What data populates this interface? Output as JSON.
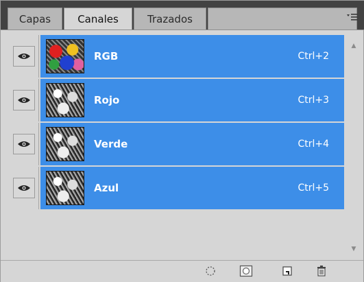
{
  "tabs": [
    {
      "label": "Capas",
      "active": false
    },
    {
      "label": "Canales",
      "active": true
    },
    {
      "label": "Trazados",
      "active": false
    }
  ],
  "panel_menu_icon": "panel-menu-icon",
  "channels": [
    {
      "name": "RGB",
      "shortcut": "Ctrl+2",
      "thumbnail": "color",
      "visible": true,
      "selected": true
    },
    {
      "name": "Rojo",
      "shortcut": "Ctrl+3",
      "thumbnail": "grayscale",
      "visible": true,
      "selected": true
    },
    {
      "name": "Verde",
      "shortcut": "Ctrl+4",
      "thumbnail": "grayscale",
      "visible": true,
      "selected": true
    },
    {
      "name": "Azul",
      "shortcut": "Ctrl+5",
      "thumbnail": "grayscale",
      "visible": true,
      "selected": true
    }
  ],
  "toolbar_icons": [
    "load-selection-icon",
    "save-selection-icon",
    "new-channel-icon",
    "delete-channel-icon"
  ],
  "colors": {
    "selection": "#3d8ee8",
    "panel_bg": "#d6d6d6",
    "tab_bar_bg": "#424242"
  }
}
